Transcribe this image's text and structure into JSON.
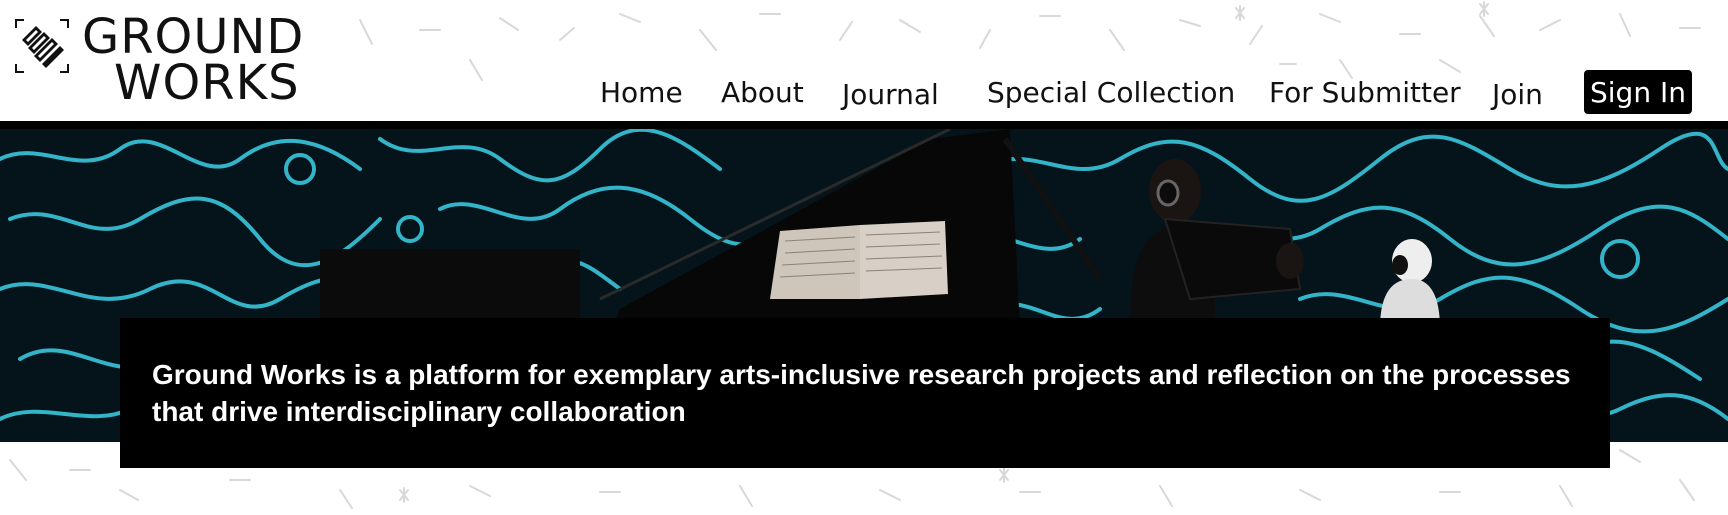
{
  "brand": {
    "line1": "GROUND",
    "line2": "WORKS",
    "icon": "stacked-slashes-logo-icon"
  },
  "nav": {
    "items": [
      {
        "label": "Home"
      },
      {
        "label": "About"
      },
      {
        "label": "Journal"
      },
      {
        "label": "Special Collection"
      },
      {
        "label": "For Submitter"
      },
      {
        "label": "Join"
      }
    ],
    "signin_label": "Sign In"
  },
  "hero": {
    "image": "hero-photo-pianist-with-projected-contour-lines",
    "accent_color": "#39c6dc",
    "caption": "Ground Works is a platform for exemplary arts-inclusive research projects and reflection on the processes that drive interdisciplinary collaboration"
  }
}
